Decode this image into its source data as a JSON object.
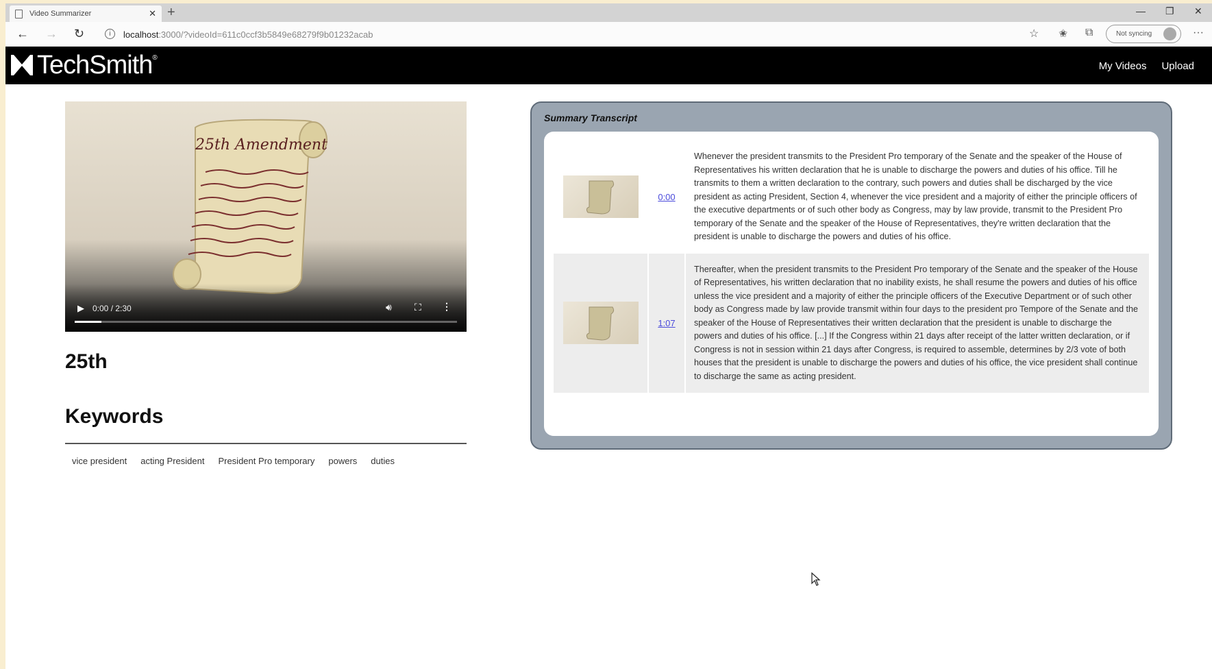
{
  "browser": {
    "tab_title": "Video Summarizer",
    "url_host": "localhost",
    "url_rest": ":3000/?videoId=611c0ccf3b5849e6827​9f9b01232acab",
    "sync_label": "Not syncing"
  },
  "site": {
    "logo": "TechSmith",
    "logo_mark": "®",
    "nav": {
      "my_videos": "My Videos",
      "upload": "Upload"
    }
  },
  "video": {
    "time": "0:00 / 2:30",
    "progress": 0.07,
    "title": "25th",
    "poster_caption": "25th Amendment"
  },
  "keywords": {
    "heading": "Keywords",
    "items": [
      "vice president",
      "acting President",
      "President Pro temporary",
      "powers",
      "duties"
    ]
  },
  "summary": {
    "title": "Summary Transcript",
    "rows": [
      {
        "time": "0:00",
        "text": "Whenever the president transmits to the President Pro temporary of the Senate and the speaker of the House of Representatives his written declaration that he is unable to discharge the powers and duties of his office. Till he transmits to them a written declaration to the contrary, such powers and duties shall be discharged by the vice president as acting President, Section 4, whenever the vice president and a majority of either the principle officers of the executive departments or of such other body as Congress, may by law provide, transmit to the President Pro temporary of the Senate and the speaker of the House of Representatives, they're written declaration that the president is unable to discharge the powers and duties of his office."
      },
      {
        "time": "1:07",
        "text": "Thereafter, when the president transmits to the President Pro temporary of the Senate and the speaker of the House of Representatives, his written declaration that no inability exists, he shall resume the powers and duties of his office unless the vice president and a majority of either the principle officers of the Executive Department or of such other body as Congress made by law provide transmit within four days to the president pro Tempore of the Senate and the speaker of the House of Representatives their written declaration that the president is unable to discharge the powers and duties of his office. [...] If the Congress within 21 days after receipt of the latter written declaration, or if Congress is not in session within 21 days after Congress, is required to assemble, determines by 2/3 vote of both houses that the president is unable to discharge the powers and duties of his office, the vice president shall continue to discharge the same as acting president."
      }
    ]
  }
}
